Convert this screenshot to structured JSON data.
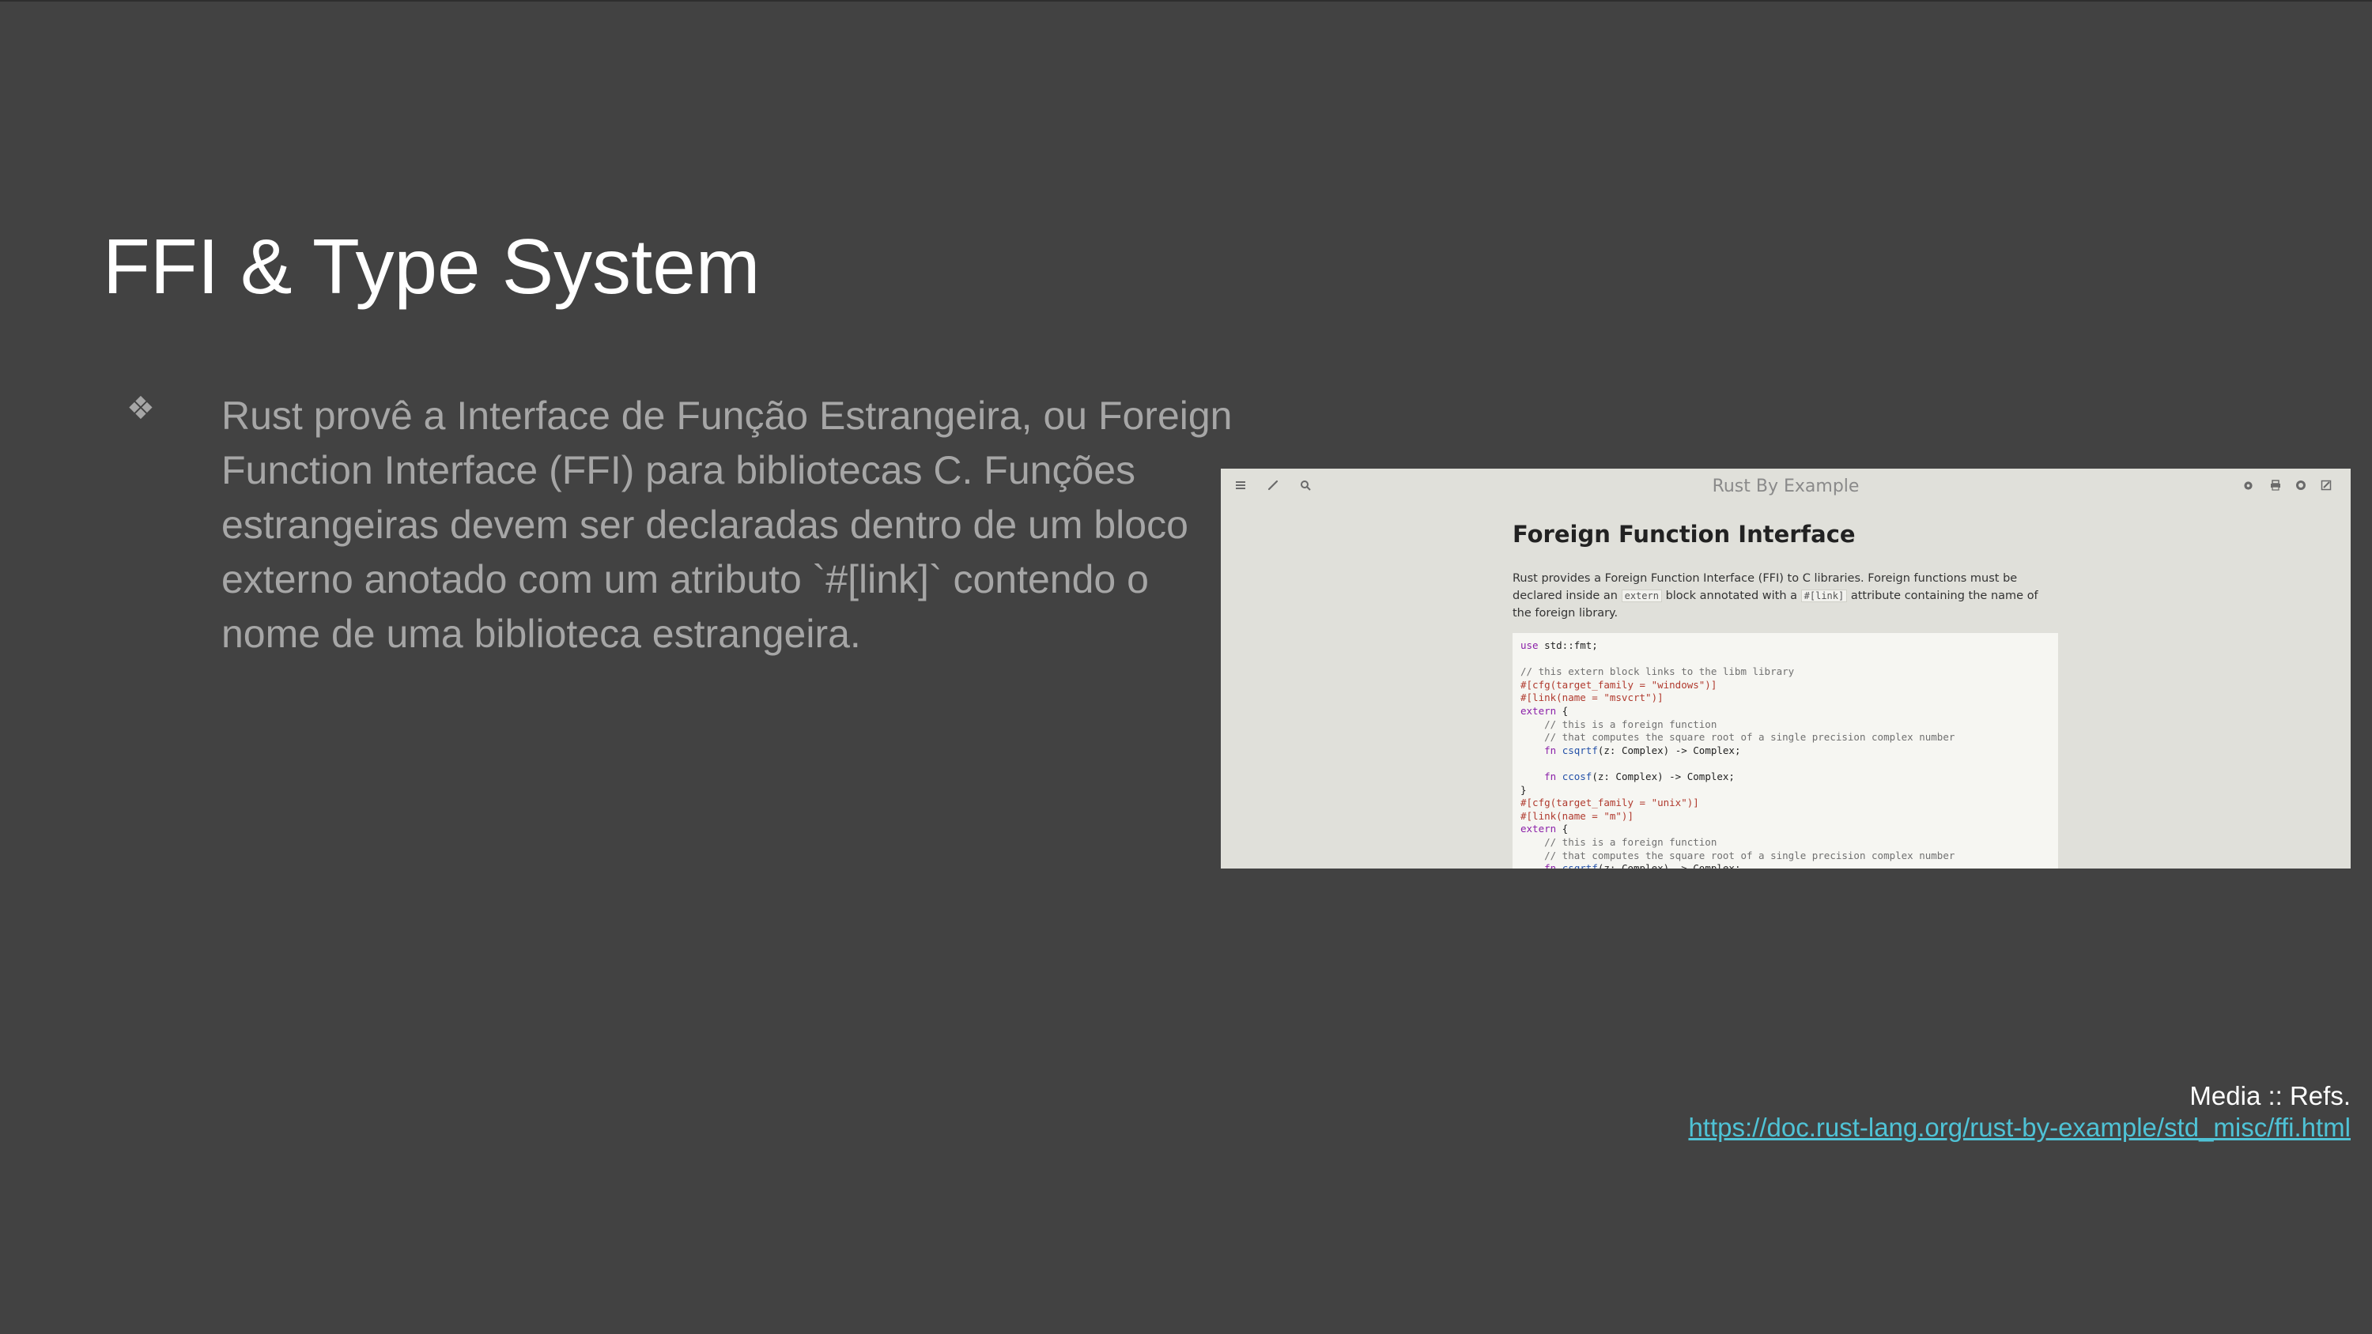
{
  "slide": {
    "title": "FFI & Type System",
    "bullet_glyph": "❖",
    "bullet_text": "Rust provê a Interface de Função Estrangeira, ou Foreign Function Interface (FFI) para bibliotecas C. Funções estrangeiras devem ser declaradas dentro de um bloco externo anotado com um atributo `#[link]` contendo o nome de uma biblioteca estrangeira."
  },
  "embedded_screenshot": {
    "toolbar": {
      "title": "Rust By Example",
      "left_icons": [
        "menu-icon",
        "brush-icon",
        "search-icon"
      ],
      "right_icons": [
        "globe-icon",
        "print-icon",
        "github-icon",
        "edit-icon"
      ]
    },
    "heading": "Foreign Function Interface",
    "paragraph": {
      "part1": "Rust provides a Foreign Function Interface (FFI) to C libraries. Foreign functions must be declared inside an ",
      "code1": "extern",
      "part2": " block annotated with a ",
      "code2": "#[link]",
      "part3": " attribute containing the name of the foreign library."
    },
    "code_lines": [
      {
        "type": "use",
        "kw": "use",
        "rest": " std::fmt;"
      },
      {
        "type": "blank"
      },
      {
        "type": "comment",
        "text": "// this extern block links to the libm library"
      },
      {
        "type": "attr",
        "text": "#[cfg(target_family = \"windows\")]"
      },
      {
        "type": "attr",
        "text": "#[link(name = \"msvcrt\")]"
      },
      {
        "type": "kwline",
        "kw": "extern",
        "rest": " {"
      },
      {
        "type": "comment",
        "text": "    // this is a foreign function"
      },
      {
        "type": "comment",
        "text": "    // that computes the square root of a single precision complex number"
      },
      {
        "type": "fn",
        "indent": "    ",
        "kw": "fn",
        "name": " csqrtf",
        "rest": "(z: Complex) -> Complex;"
      },
      {
        "type": "blank"
      },
      {
        "type": "fn",
        "indent": "    ",
        "kw": "fn",
        "name": " ccosf",
        "rest": "(z: Complex) -> Complex;"
      },
      {
        "type": "plain",
        "text": "}"
      },
      {
        "type": "attr",
        "text": "#[cfg(target_family = \"unix\")]"
      },
      {
        "type": "attr",
        "text": "#[link(name = \"m\")]"
      },
      {
        "type": "kwline",
        "kw": "extern",
        "rest": " {"
      },
      {
        "type": "comment",
        "text": "    // this is a foreign function"
      },
      {
        "type": "comment",
        "text": "    // that computes the square root of a single precision complex number"
      },
      {
        "type": "fn",
        "indent": "    ",
        "kw": "fn",
        "name": " csqrtf",
        "rest": "(z: Complex) -> Complex;"
      }
    ]
  },
  "refs": {
    "label": "Media :: Refs.",
    "link": "https://doc.rust-lang.org/rust-by-example/std_misc/ffi.html"
  }
}
